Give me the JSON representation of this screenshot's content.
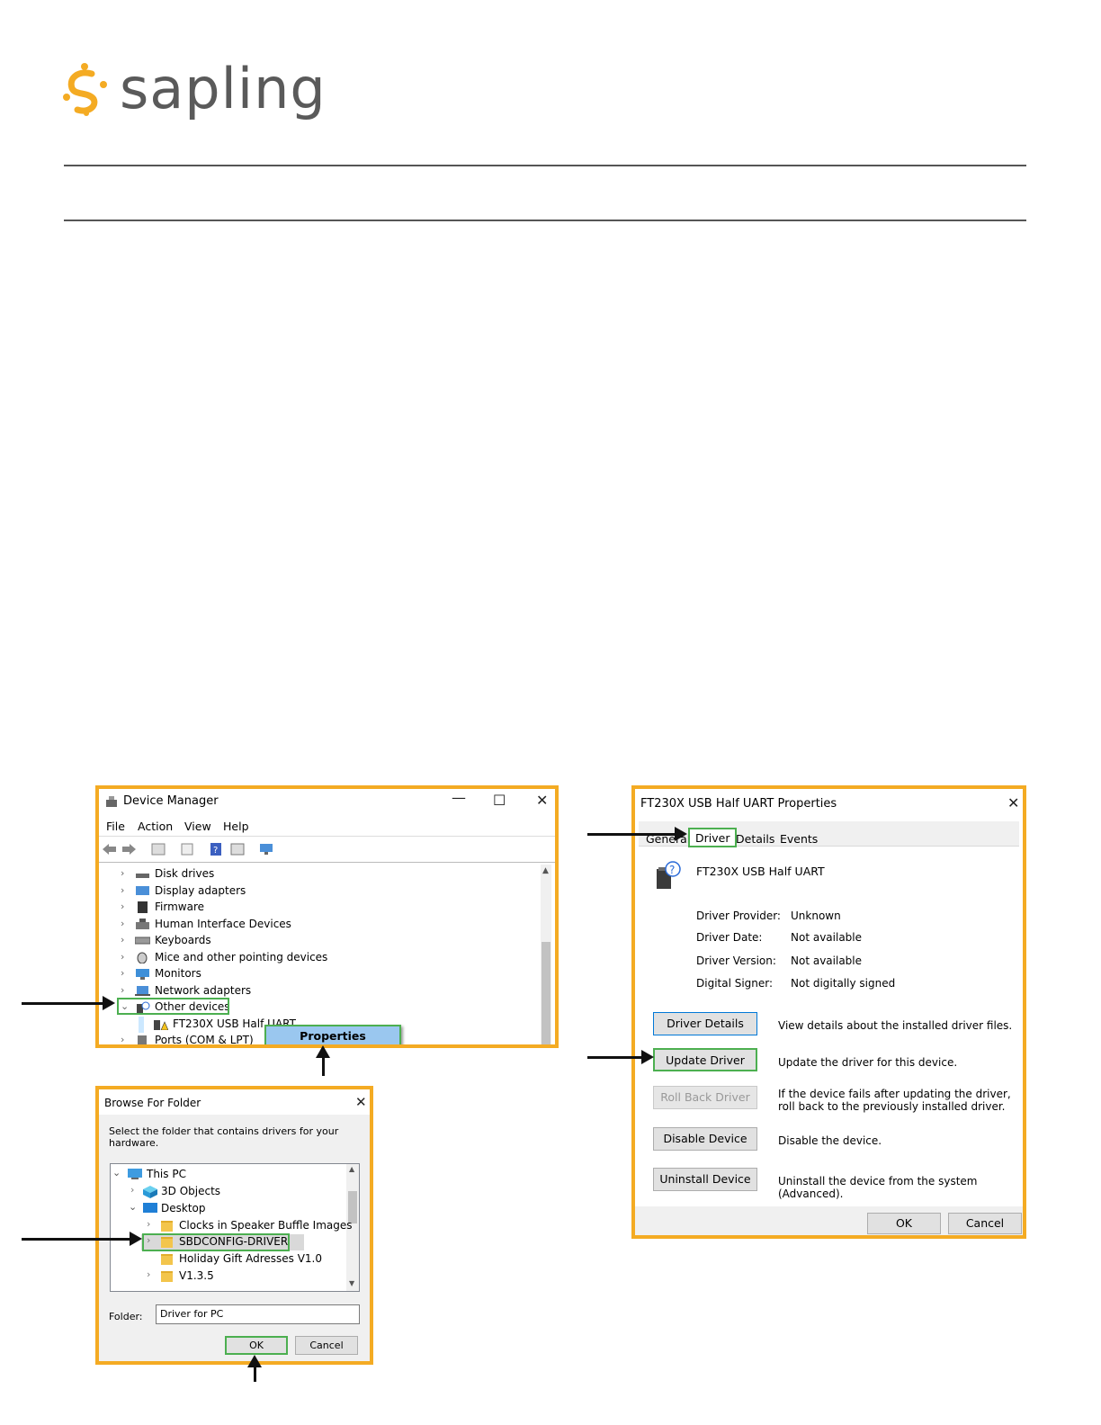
{
  "brand": {
    "name": "sapling",
    "accent": "#f4ab23",
    "text_color": "#5a5a5a"
  },
  "device_manager": {
    "title": "Device Manager",
    "menu": [
      "File",
      "Action",
      "View",
      "Help"
    ],
    "tree": [
      {
        "label": "Disk drives",
        "icon": "disk-drive-icon"
      },
      {
        "label": "Display adapters",
        "icon": "display-adapter-icon"
      },
      {
        "label": "Firmware",
        "icon": "firmware-icon"
      },
      {
        "label": "Human Interface Devices",
        "icon": "hid-icon"
      },
      {
        "label": "Keyboards",
        "icon": "keyboard-icon"
      },
      {
        "label": "Mice and other pointing devices",
        "icon": "mouse-icon"
      },
      {
        "label": "Monitors",
        "icon": "monitor-icon"
      },
      {
        "label": "Network adapters",
        "icon": "network-adapter-icon"
      },
      {
        "label": "Other devices",
        "icon": "unknown-device-icon"
      },
      {
        "label": "FT230X USB Half UART",
        "icon": "warning-device-icon"
      },
      {
        "label": "Ports (COM & LPT)",
        "icon": "port-icon"
      }
    ],
    "context_menu": {
      "properties": "Properties"
    }
  },
  "properties_dialog": {
    "title": "FT230X USB Half UART Properties",
    "tabs": [
      "General",
      "Driver",
      "Details",
      "Events"
    ],
    "device_name": "FT230X USB Half UART",
    "fields": [
      {
        "label": "Driver Provider:",
        "value": "Unknown"
      },
      {
        "label": "Driver Date:",
        "value": "Not available"
      },
      {
        "label": "Driver Version:",
        "value": "Not available"
      },
      {
        "label": "Digital Signer:",
        "value": "Not digitally signed"
      }
    ],
    "buttons": [
      {
        "label": "Driver Details",
        "desc": "View details about the installed driver files."
      },
      {
        "label": "Update Driver",
        "desc": "Update the driver for this device."
      },
      {
        "label": "Roll Back Driver",
        "desc": "If the device fails after updating the driver, roll back to the previously installed driver."
      },
      {
        "label": "Disable Device",
        "desc": "Disable the device."
      },
      {
        "label": "Uninstall Device",
        "desc": "Uninstall the device from the system (Advanced)."
      }
    ],
    "ok": "OK",
    "cancel": "Cancel"
  },
  "browse_dialog": {
    "title": "Browse For Folder",
    "instruction": "Select the folder that contains drivers for your hardware.",
    "tree": [
      {
        "label": "This PC"
      },
      {
        "label": "3D Objects"
      },
      {
        "label": "Desktop"
      },
      {
        "label": "Clocks in Speaker Buffle Images"
      },
      {
        "label": "SBDCONFIG-DRIVER"
      },
      {
        "label": "Holiday Gift Adresses V1.0"
      },
      {
        "label": "V1.3.5"
      }
    ],
    "folder_label": "Folder:",
    "folder_value": "Driver for PC",
    "ok": "OK",
    "cancel": "Cancel"
  }
}
